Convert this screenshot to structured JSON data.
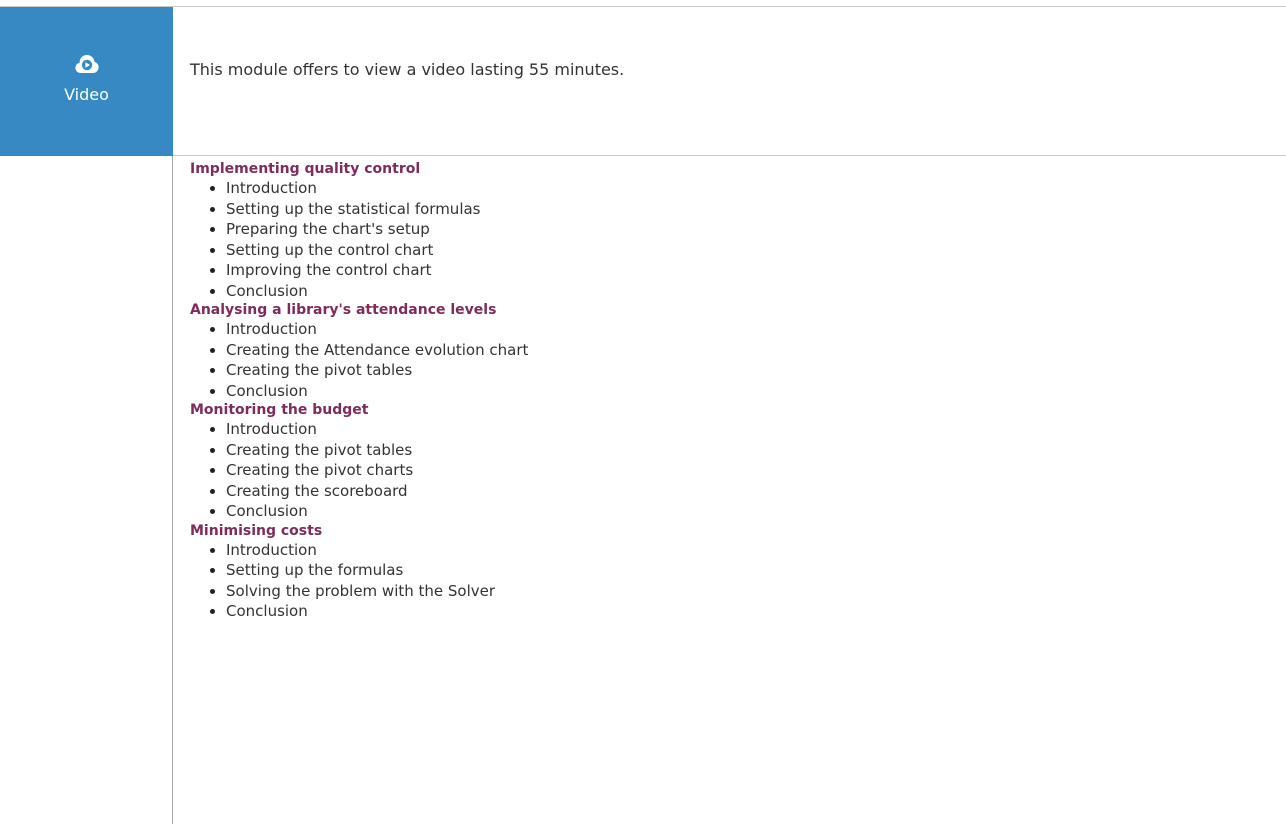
{
  "module": {
    "icon": "video-play-cloud-icon",
    "label": "Video",
    "description": "This module offers to view a video lasting 55 minutes.",
    "accent_color": "#3789c3"
  },
  "title_color": "#7e2c5a",
  "sections": [
    {
      "title": "Implementing quality control",
      "items": [
        "Introduction",
        "Setting up the statistical formulas",
        "Preparing the chart's setup",
        "Setting up the control chart",
        "Improving the control chart",
        "Conclusion"
      ]
    },
    {
      "title": "Analysing a library's attendance levels",
      "items": [
        "Introduction",
        "Creating the Attendance evolution chart",
        "Creating the pivot tables",
        "Conclusion"
      ]
    },
    {
      "title": "Monitoring the budget",
      "items": [
        "Introduction",
        "Creating the pivot tables",
        "Creating the pivot charts",
        "Creating the scoreboard",
        "Conclusion"
      ]
    },
    {
      "title": "Minimising costs",
      "items": [
        "Introduction",
        "Setting up the formulas",
        "Solving the problem with the Solver",
        "Conclusion"
      ]
    }
  ]
}
